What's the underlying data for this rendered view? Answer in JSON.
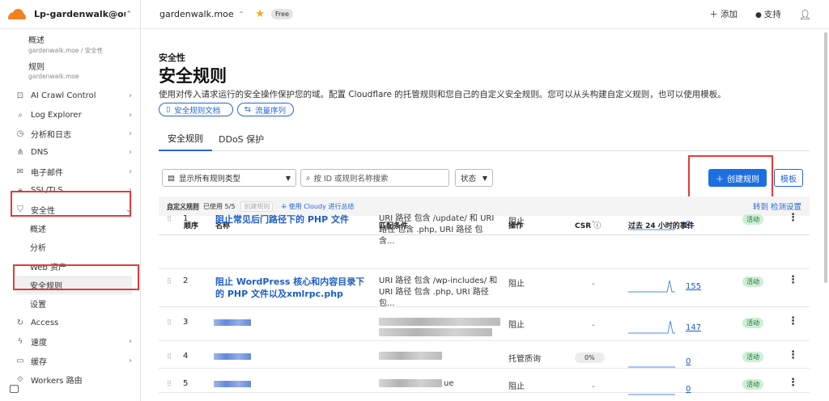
{
  "account": {
    "name": "Lp-gardenwalk@outl...",
    "chevron": "⌃⌄"
  },
  "sidebar": {
    "sub_items": [
      {
        "title": "概述",
        "crumb": "gardenwalk.moe / 安全性"
      },
      {
        "title": "规则",
        "crumb": "gardenwalk.moe"
      }
    ],
    "items": [
      {
        "label": "AI Crawl Control",
        "icon": "ai-crawl-icon",
        "glyph": "⊡"
      },
      {
        "label": "Log Explorer",
        "icon": "log-explorer-icon",
        "glyph": "⌕"
      },
      {
        "label": "分析和日志",
        "icon": "analytics-icon",
        "glyph": "◷"
      },
      {
        "label": "DNS",
        "icon": "dns-icon",
        "glyph": "⋔"
      },
      {
        "label": "电子邮件",
        "icon": "email-icon",
        "glyph": "✉"
      },
      {
        "label": "SSL/TLS",
        "icon": "lock-icon",
        "glyph": "🔒︎"
      },
      {
        "label": "安全性",
        "icon": "shield-icon",
        "glyph": "⛉"
      }
    ],
    "security_children": [
      "概述",
      "分析",
      "Web 资产",
      "安全规则",
      "设置"
    ],
    "after_items": [
      {
        "label": "Access",
        "icon": "access-icon",
        "glyph": "↻"
      },
      {
        "label": "速度",
        "icon": "speed-icon",
        "glyph": "ϟ"
      },
      {
        "label": "缓存",
        "icon": "cache-icon",
        "glyph": "▭"
      },
      {
        "label": "Workers 路由",
        "icon": "workers-icon",
        "glyph": "⟐"
      }
    ]
  },
  "topbar": {
    "zone": "gardenwalk.moe",
    "plan": "Free",
    "add": "添加",
    "support": "支持"
  },
  "page": {
    "kicker": "安全性",
    "title": "安全规则",
    "description": "使用对传入请求运行的安全操作保护您的域。配置 Cloudflare 的托管规则和您自己的自定义安全规则。您可以从头构建自定义规则，也可以使用模板。",
    "doc_link": "安全规则文档",
    "order_link": "流量序列"
  },
  "tabs": [
    "安全规则",
    "DDoS 保护"
  ],
  "toolbar": {
    "filter": "显示所有规则类型",
    "search_placeholder": "按 ID 或规则名称搜索",
    "status": "状态",
    "create": "创建规则",
    "templates": "模板"
  },
  "usage": {
    "label": "自定义规则",
    "used": "已使用 5/5",
    "disabled_btn": "创建规则",
    "ai": "使用 Cloudy 进行总结",
    "goto": "转到 检测设置"
  },
  "table": {
    "headers": {
      "order": "顺序",
      "name": "名称",
      "condition": "匹配条件",
      "action": "操作",
      "csr": "CSR",
      "events": "过去 24 小时的事件"
    },
    "rows": [
      {
        "order": "1",
        "name": "阻止常见后门路径下的 PHP 文件",
        "condition": "URI 路径 包含 /update/ 和 URI 路径 包含 .php, URI 路径 包含...",
        "action": "阻止",
        "csr": "-",
        "events": "0",
        "status": "活动"
      },
      {
        "order": "2",
        "name": "阻止 WordPress 核心和内容目录下的 PHP 文件以及xmlrpc.php",
        "condition": "URI 路径 包含 /wp-includes/ 和 URI 路径 包含 .php, URI 路径 包...",
        "action": "阻止",
        "csr": "-",
        "events": "155",
        "status": "活动"
      },
      {
        "order": "3",
        "name": "",
        "condition": "",
        "action": "阻止",
        "csr": "-",
        "events": "147",
        "status": "活动"
      },
      {
        "order": "4",
        "name": "",
        "condition": "",
        "action": "托管质询",
        "csr": "0%",
        "events": "0",
        "status": "活动"
      },
      {
        "order": "5",
        "name": "",
        "condition": "ue",
        "action": "阻止",
        "csr": "-",
        "events": "0",
        "status": "活动"
      }
    ]
  }
}
